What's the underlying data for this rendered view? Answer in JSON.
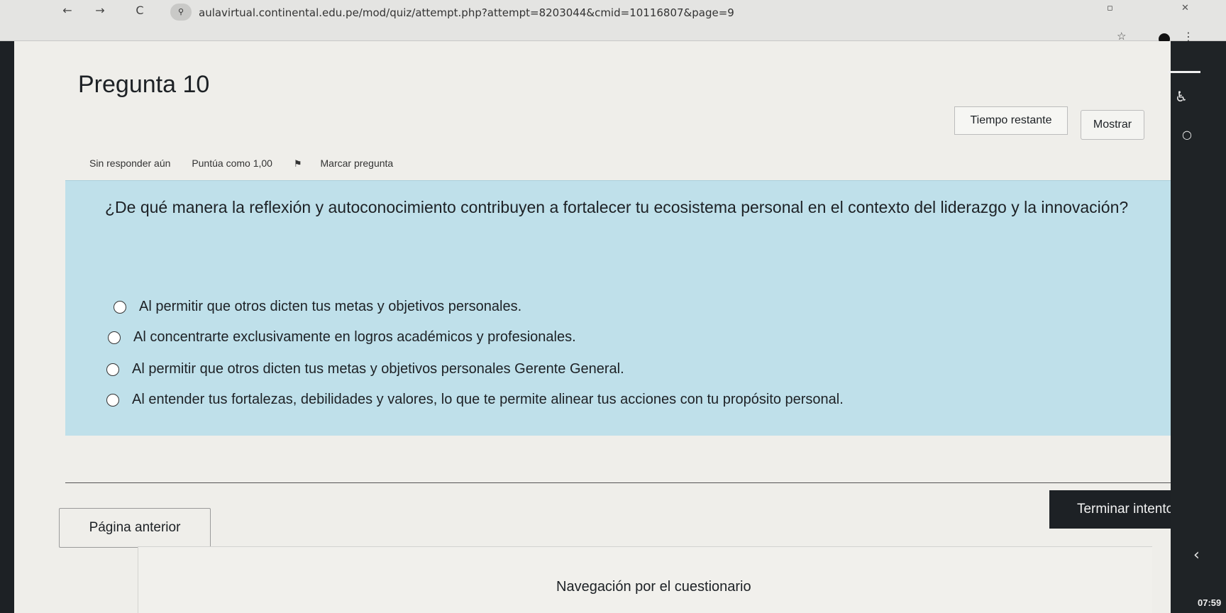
{
  "browser": {
    "back_glyph": "←",
    "forward_glyph": "→",
    "reload_glyph": "C",
    "site_info_glyph": "⚲",
    "url": "aulavirtual.continental.edu.pe/mod/quiz/attempt.php?attempt=8203044&cmid=10116807&page=9",
    "bookmark_glyph": "☆",
    "menu_glyph": "⋮",
    "restore_glyph": "▫",
    "close_glyph": "✕"
  },
  "question": {
    "title": "Pregunta 10",
    "status": "Sin responder aún",
    "points": "Puntúa como 1,00",
    "flag_label": "Marcar pregunta",
    "text": "¿De qué manera la reflexión y autoconocimiento contribuyen a fortalecer tu ecosistema personal en el contexto del liderazgo y la innovación?",
    "options": [
      {
        "label": "Al permitir que otros dicten tus metas y objetivos personales.",
        "selected": false
      },
      {
        "label": "Al concentrarte exclusivamente en logros académicos y profesionales.",
        "selected": false
      },
      {
        "label": "Al permitir que otros dicten tus metas y objetivos personales Gerente General.",
        "selected": false
      },
      {
        "label": "Al entender tus fortalezas, debilidades y valores, lo que te permite alinear tus acciones con tu propósito personal.",
        "selected": false
      }
    ]
  },
  "timer": {
    "label": "Tiempo restante",
    "show_button": "Mostrar"
  },
  "navigation": {
    "previous": "Página anterior",
    "finish": "Terminar intento...",
    "quiz_nav_title": "Navegación por el cuestionario"
  },
  "drawer": {
    "clock": "07:59",
    "collapse_glyph": "‹"
  },
  "colors": {
    "question_bg": "#bfe0ea",
    "primary_button": "#1d2125",
    "page_bg": "#efeeea"
  }
}
